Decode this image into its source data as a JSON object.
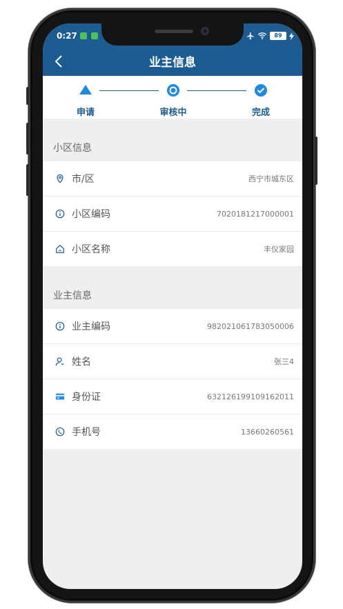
{
  "status_bar": {
    "time": "0:27",
    "battery": "89"
  },
  "header": {
    "title": "业主信息"
  },
  "steps": [
    {
      "label": "申请"
    },
    {
      "label": "审核中"
    },
    {
      "label": "完成"
    }
  ],
  "community": {
    "section_title": "小区信息",
    "rows": [
      {
        "label": "市/区",
        "value": "西宁市城东区",
        "icon": "location-pin-icon"
      },
      {
        "label": "小区编码",
        "value": "7020181217000001",
        "icon": "info-icon"
      },
      {
        "label": "小区名称",
        "value": "丰仪家园",
        "icon": "home-icon"
      }
    ]
  },
  "owner": {
    "section_title": "业主信息",
    "rows": [
      {
        "label": "业主编码",
        "value": "982021061783050006",
        "icon": "info-icon"
      },
      {
        "label": "姓名",
        "value": "张三4",
        "icon": "person-icon"
      },
      {
        "label": "身份证",
        "value": "632126199109162011",
        "icon": "id-card-icon"
      },
      {
        "label": "手机号",
        "value": "13660260561",
        "icon": "phone-icon"
      }
    ]
  },
  "colors": {
    "primary": "#1c5c92",
    "background": "#efefef",
    "accent": "#1e88e5"
  }
}
